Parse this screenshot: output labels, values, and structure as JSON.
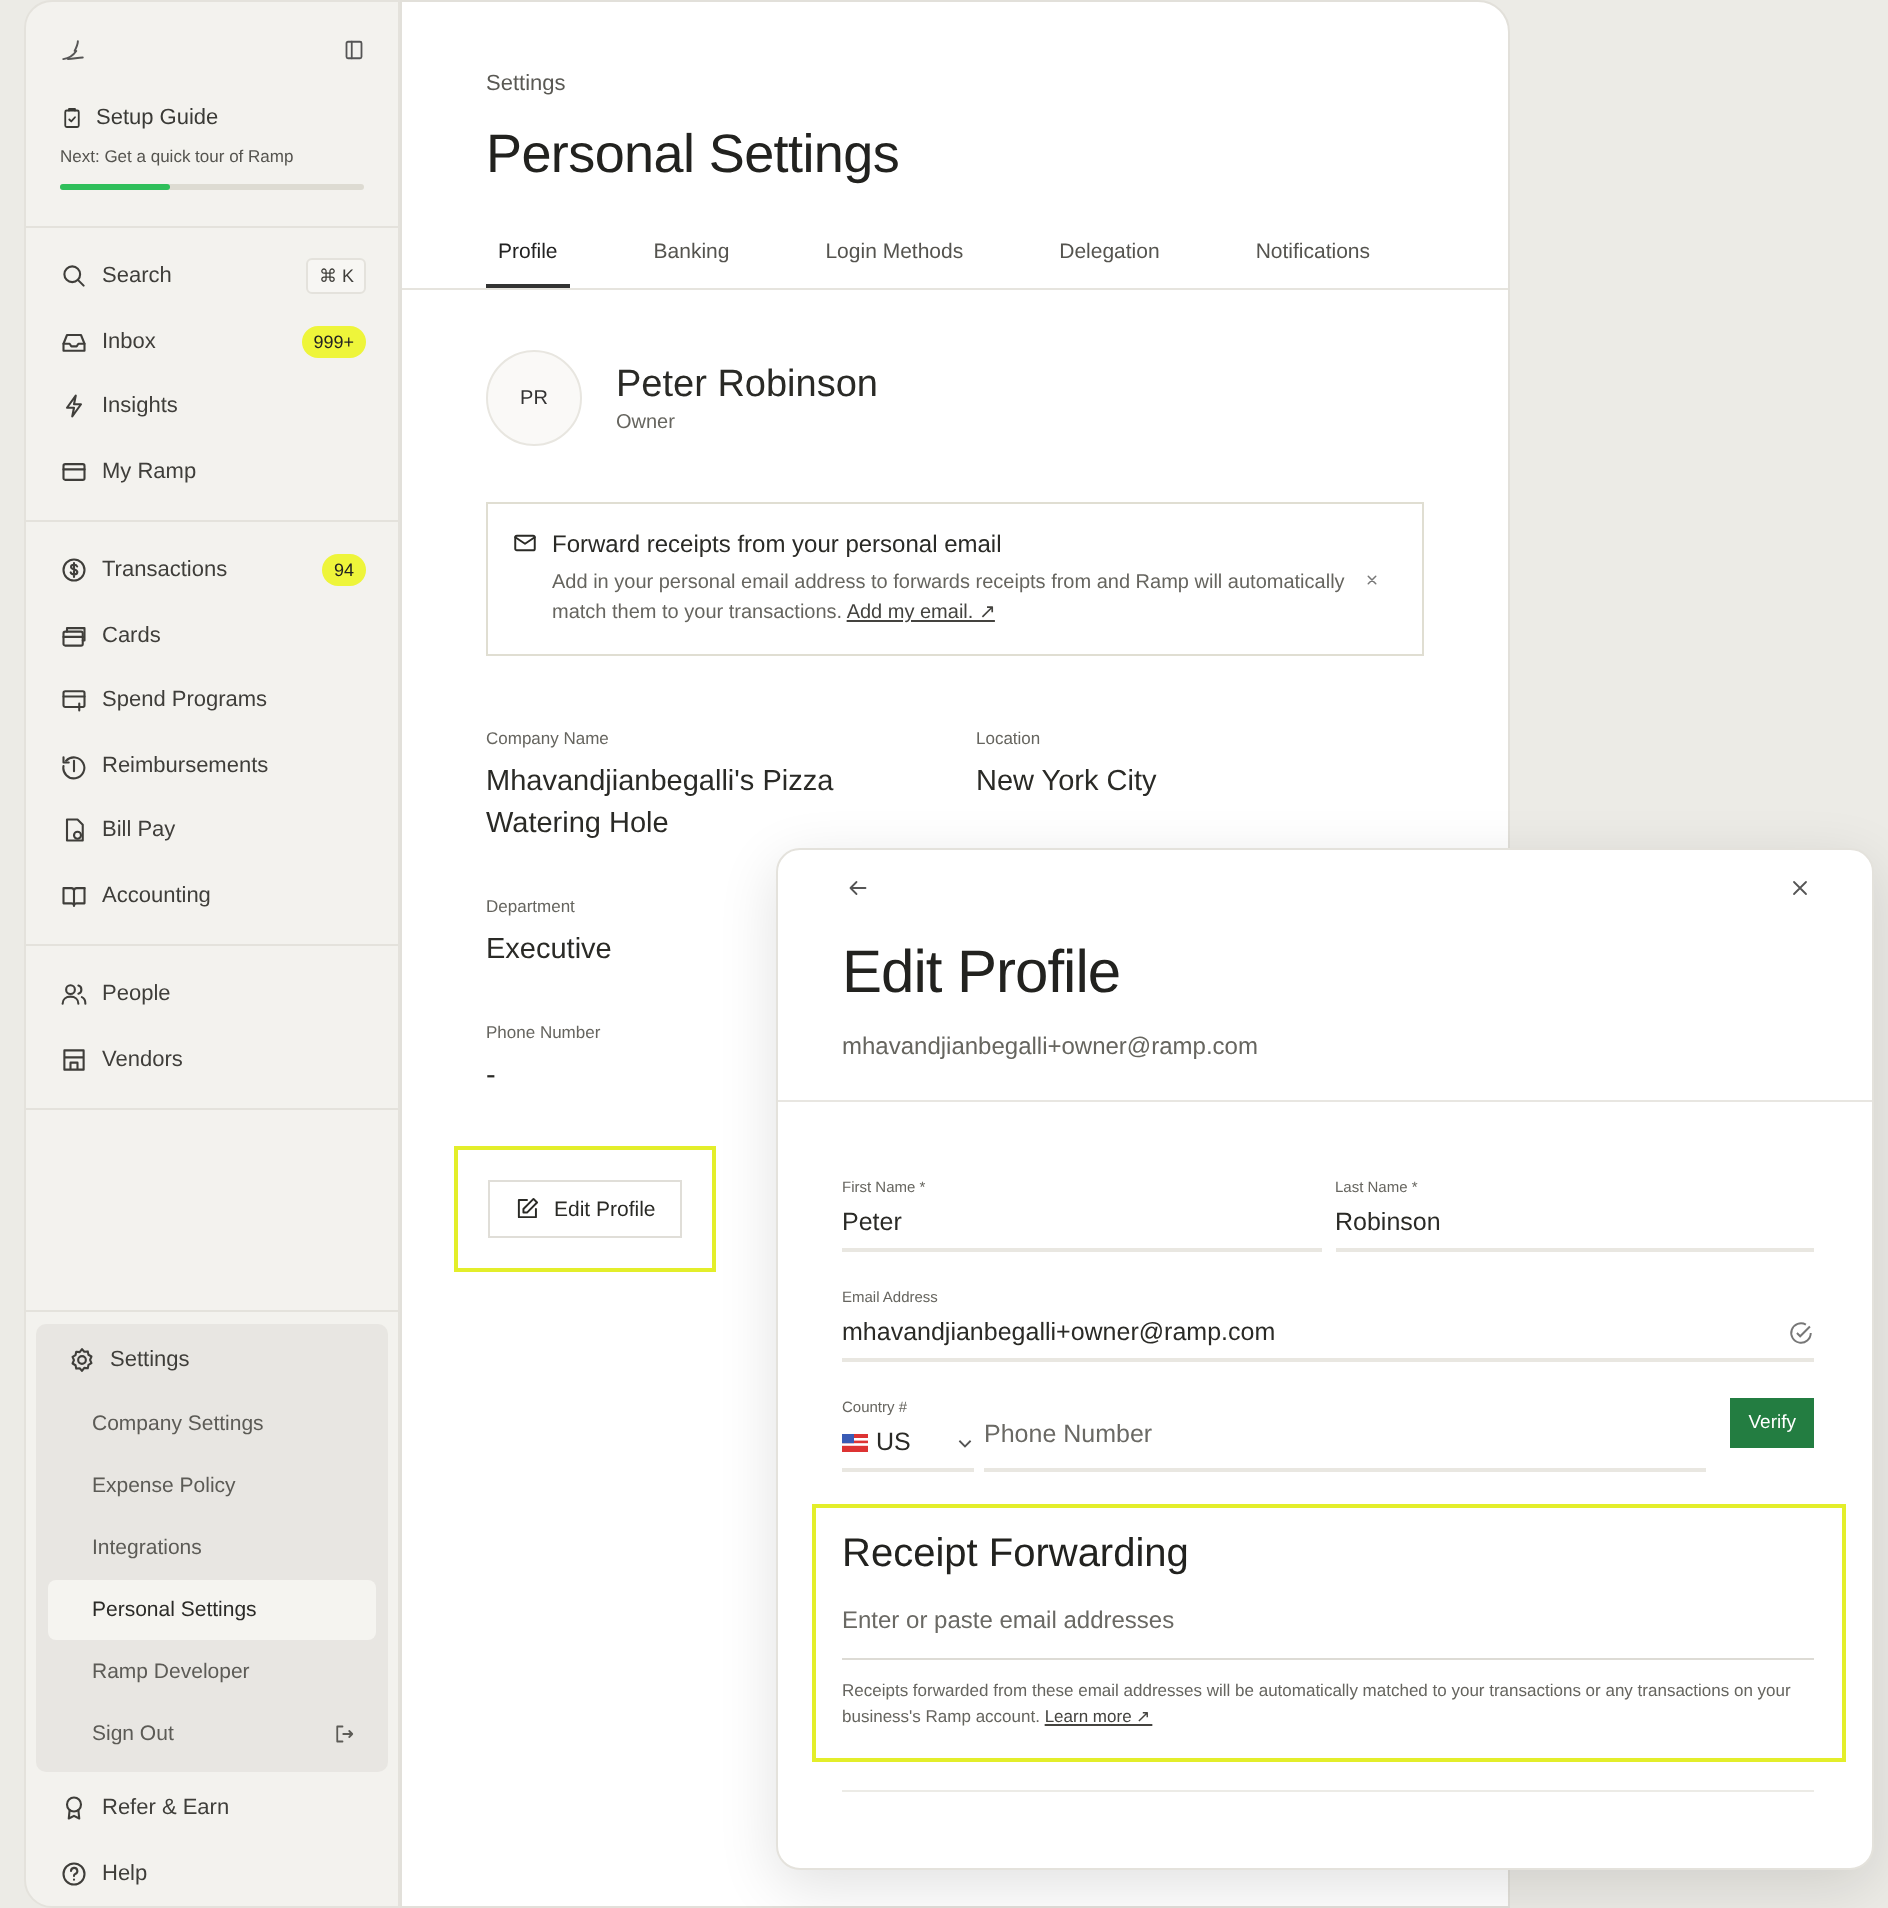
{
  "sidebar": {
    "setup_guide": {
      "title": "Setup Guide",
      "subtitle": "Next: Get a quick tour of Ramp",
      "level": 0.36
    },
    "sections": [
      {
        "items": [
          {
            "label": "Search",
            "shortcut": "⌘ K"
          },
          {
            "label": "Inbox",
            "badge": "999+"
          },
          {
            "label": "Insights"
          },
          {
            "label": "My Ramp"
          }
        ]
      },
      {
        "items": [
          {
            "label": "Transactions",
            "badge": "94"
          },
          {
            "label": "Cards"
          },
          {
            "label": "Spend Programs"
          },
          {
            "label": "Reimbursements"
          },
          {
            "label": "Bill Pay"
          },
          {
            "label": "Accounting"
          }
        ]
      },
      {
        "items": [
          {
            "label": "People"
          },
          {
            "label": "Vendors"
          }
        ]
      }
    ],
    "settings": {
      "label": "Settings",
      "items": [
        {
          "label": "Company Settings",
          "selected": false
        },
        {
          "label": "Expense Policy",
          "selected": false
        },
        {
          "label": "Integrations",
          "selected": false
        },
        {
          "label": "Personal Settings",
          "selected": true
        },
        {
          "label": "Ramp Developer",
          "selected": false
        },
        {
          "label": "Sign Out",
          "selected": false
        }
      ]
    },
    "footer": [
      {
        "label": "Refer & Earn"
      },
      {
        "label": "Help"
      }
    ]
  },
  "main": {
    "breadcrumb": "Settings",
    "title": "Personal Settings",
    "tabs": [
      {
        "label": "Profile",
        "selected": true
      },
      {
        "label": "Banking",
        "selected": false
      },
      {
        "label": "Login Methods",
        "selected": false
      },
      {
        "label": "Delegation",
        "selected": false
      },
      {
        "label": "Notifications",
        "selected": false
      }
    ],
    "profile": {
      "initials": "PR",
      "name": "Peter Robinson",
      "role": "Owner"
    },
    "banner": {
      "title": "Forward receipts from your personal email",
      "text": "Add in your personal email address to forwards receipts from and Ramp will automatically match them to your transactions.",
      "link": "Add my email. ↗"
    },
    "field_rows": [
      [
        {
          "label": "Company Name",
          "value": "Mhavandjianbegalli's Pizza Watering Hole"
        },
        {
          "label": "Location",
          "value": "New York City"
        }
      ],
      [
        {
          "label": "Department",
          "value": "Executive"
        }
      ],
      [
        {
          "label": "Phone Number",
          "value": "-"
        }
      ]
    ],
    "edit_button": {
      "label": "Edit Profile",
      "highlighted": true
    }
  },
  "modal": {
    "title": "Edit Profile",
    "subtitle": "mhavandjianbegalli+owner@ramp.com",
    "first_name": {
      "label": "First Name *",
      "value": "Peter"
    },
    "last_name": {
      "label": "Last Name *",
      "value": "Robinson"
    },
    "email": {
      "label": "Email Address",
      "value": "mhavandjianbegalli+owner@ramp.com",
      "verified": true
    },
    "country": {
      "label": "Country #",
      "value": "US"
    },
    "phone": {
      "placeholder": "Phone Number"
    },
    "verify_button": "Verify",
    "receipt_forwarding": {
      "title": "Receipt Forwarding",
      "placeholder": "Enter or paste email addresses",
      "note": "Receipts forwarded from these email addresses will be automatically matched to your transactions or any transactions on your business's Ramp account.",
      "link": "Learn more ↗",
      "highlighted": true
    }
  }
}
